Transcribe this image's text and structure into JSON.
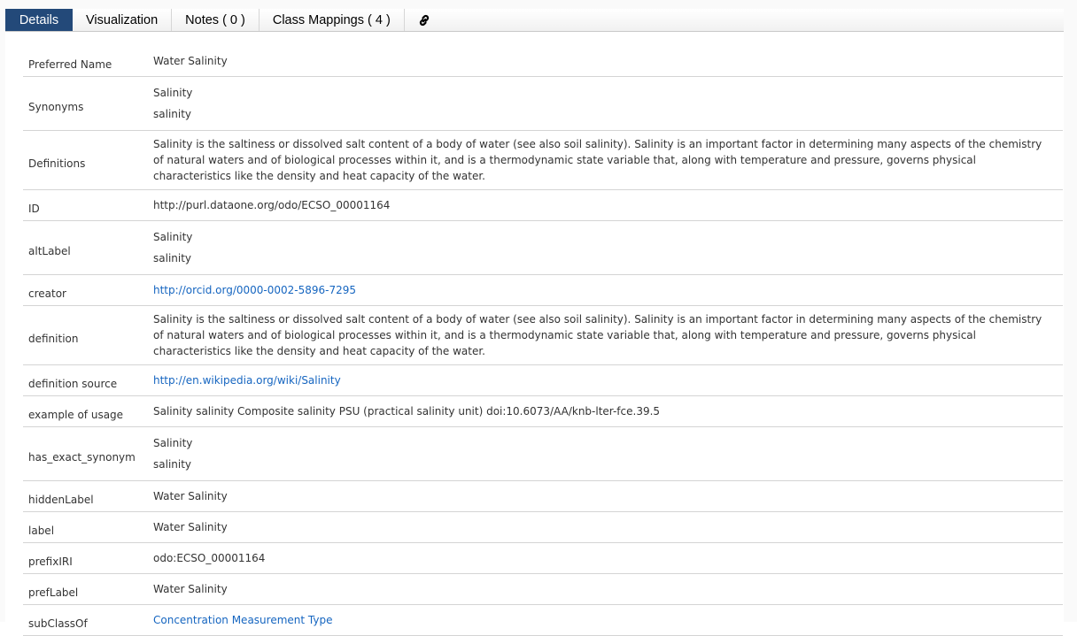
{
  "tabs": [
    {
      "label": "Details",
      "active": true
    },
    {
      "label": "Visualization",
      "active": false
    },
    {
      "label": "Notes ( 0 )",
      "active": false
    },
    {
      "label": "Class Mappings ( 4 )",
      "active": false
    }
  ],
  "link_tab_icon": "link-icon",
  "colors": {
    "active_tab": "#234979",
    "link": "#1565c0"
  },
  "rows": [
    {
      "label": "Preferred Name",
      "values": [
        "Water Salinity"
      ]
    },
    {
      "label": "Synonyms",
      "values": [
        "Salinity",
        "salinity"
      ]
    },
    {
      "label": "Definitions",
      "paragraph": "Salinity is the saltiness or dissolved salt content of a body of water (see also soil salinity). Salinity is an important factor in determining many aspects of the chemistry of natural waters and of biological processes within it, and is a thermodynamic state variable that, along with temperature and pressure, governs physical characteristics like the density and heat capacity of the water."
    },
    {
      "label": "ID",
      "values": [
        "http://purl.dataone.org/odo/ECSO_00001164"
      ]
    },
    {
      "label": "altLabel",
      "values": [
        "Salinity",
        "salinity"
      ]
    },
    {
      "label": "creator",
      "link": "http://orcid.org/0000-0002-5896-7295"
    },
    {
      "label": "definition",
      "paragraph": "Salinity is the saltiness or dissolved salt content of a body of water (see also soil salinity). Salinity is an important factor in determining many aspects of the chemistry of natural waters and of biological processes within it, and is a thermodynamic state variable that, along with temperature and pressure, governs physical characteristics like the density and heat capacity of the water."
    },
    {
      "label": "definition source",
      "link": "http://en.wikipedia.org/wiki/Salinity"
    },
    {
      "label": "example of usage",
      "values": [
        "Salinity salinity Composite salinity PSU (practical salinity unit) doi:10.6073/AA/knb-lter-fce.39.5"
      ]
    },
    {
      "label": "has_exact_synonym",
      "values": [
        "Salinity",
        "salinity"
      ]
    },
    {
      "label": "hiddenLabel",
      "values": [
        "Water Salinity"
      ]
    },
    {
      "label": "label",
      "values": [
        "Water Salinity"
      ]
    },
    {
      "label": "prefixIRI",
      "values": [
        "odo:ECSO_00001164"
      ]
    },
    {
      "label": "prefLabel",
      "values": [
        "Water Salinity"
      ]
    },
    {
      "label": "subClassOf",
      "link": "Concentration Measurement Type"
    }
  ]
}
